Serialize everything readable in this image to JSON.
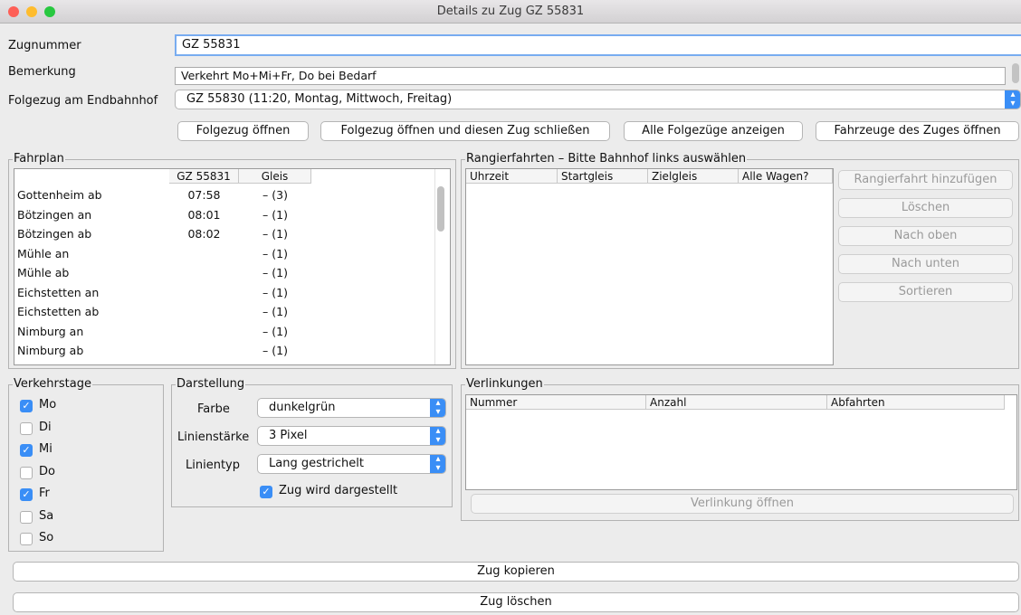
{
  "window": {
    "title": "Details zu Zug GZ 55831"
  },
  "form": {
    "zugnummer_label": "Zugnummer",
    "zugnummer_value": "GZ 55831",
    "bemerkung_label": "Bemerkung",
    "bemerkung_value": "Verkehrt Mo+Mi+Fr, Do bei Bedarf",
    "folgezug_label": "Folgezug am Endbahnhof",
    "folgezug_value": "GZ 55830 (11:20, Montag, Mittwoch, Freitag)"
  },
  "buttons": {
    "folgezug_oeffnen": "Folgezug öffnen",
    "folgezug_oeffnen_schliessen": "Folgezug öffnen und diesen Zug schließen",
    "alle_folgezuege": "Alle Folgezüge anzeigen",
    "fahrzeuge_oeffnen": "Fahrzeuge des Zuges öffnen",
    "zug_kopieren": "Zug kopieren",
    "zug_loeschen": "Zug löschen"
  },
  "fahrplan": {
    "title": "Fahrplan",
    "columns": [
      "",
      "GZ 55831",
      "Gleis"
    ],
    "rows": [
      [
        "Gottenheim ab",
        "07:58",
        "– (3)"
      ],
      [
        "Bötzingen an",
        "08:01",
        "– (1)"
      ],
      [
        "Bötzingen ab",
        "08:02",
        "– (1)"
      ],
      [
        "Mühle an",
        "",
        "– (1)"
      ],
      [
        "Mühle ab",
        "",
        "– (1)"
      ],
      [
        "Eichstetten an",
        "",
        "– (1)"
      ],
      [
        "Eichstetten ab",
        "",
        "– (1)"
      ],
      [
        "Nimburg an",
        "",
        "– (1)"
      ],
      [
        "Nimburg ab",
        "",
        "– (1)"
      ]
    ]
  },
  "rangierfahrten": {
    "title": "Rangierfahrten – Bitte Bahnhof links auswählen",
    "columns": [
      "Uhrzeit",
      "Startgleis",
      "Zielgleis",
      "Alle Wagen?"
    ],
    "buttons": [
      "Rangierfahrt hinzufügen",
      "Löschen",
      "Nach oben",
      "Nach unten",
      "Sortieren"
    ]
  },
  "verkehrstage": {
    "title": "Verkehrstage",
    "days": [
      {
        "label": "Mo",
        "checked": true
      },
      {
        "label": "Di",
        "checked": false
      },
      {
        "label": "Mi",
        "checked": true
      },
      {
        "label": "Do",
        "checked": false
      },
      {
        "label": "Fr",
        "checked": true
      },
      {
        "label": "Sa",
        "checked": false
      },
      {
        "label": "So",
        "checked": false
      }
    ]
  },
  "darstellung": {
    "title": "Darstellung",
    "farbe_label": "Farbe",
    "farbe_value": "dunkelgrün",
    "linienstaerke_label": "Linienstärke",
    "linienstaerke_value": "3 Pixel",
    "linientyp_label": "Linientyp",
    "linientyp_value": "Lang gestrichelt",
    "dargestellt_label": "Zug wird dargestellt",
    "dargestellt_checked": true
  },
  "verlinkungen": {
    "title": "Verlinkungen",
    "columns": [
      "Nummer",
      "Anzahl",
      "Abfahrten"
    ],
    "button": "Verlinkung öffnen"
  },
  "colors": {
    "accent": "#3a8ef6",
    "background": "#ececec"
  }
}
